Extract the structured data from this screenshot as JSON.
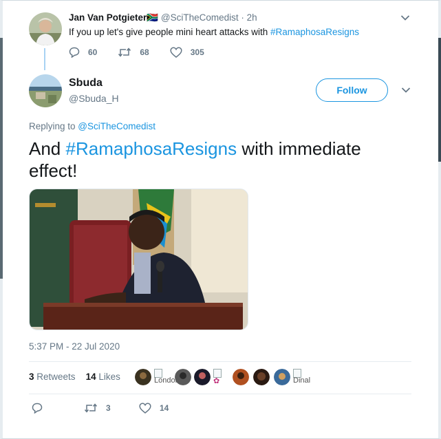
{
  "parent_tweet": {
    "name": "Jan Van Potgieter",
    "flag": "🇿🇦",
    "handle": "@SciTheComedist",
    "separator": "·",
    "time": "2h",
    "text_before": "If you up let's give people mini heart attacks with ",
    "hashtag": "#RamaphosaResigns",
    "replies": "60",
    "retweets": "68",
    "likes": "305"
  },
  "main_tweet": {
    "name": "Sbuda",
    "handle": "@Sbuda_H",
    "follow_label": "Follow",
    "replying_label": "Replying to ",
    "replying_handle": "@SciTheComedist",
    "text_prefix": "And ",
    "hashtag": "#RamaphosaResigns",
    "text_suffix": " with immediate effect!",
    "timestamp": "5:37 PM - 22 Jul 2020",
    "retweet_count": "3",
    "retweet_label": "Retweets",
    "like_count": "14",
    "like_label": "Likes",
    "liker_names": [
      "London_M",
      "Dinal"
    ],
    "action_retweets": "3",
    "action_likes": "14"
  },
  "colors": {
    "accent": "#1b95e0",
    "muted": "#657786",
    "text": "#14171a"
  },
  "icons": [
    "reply-icon",
    "retweet-icon",
    "like-icon",
    "chevron-down-icon",
    "sa-flag-icon"
  ]
}
